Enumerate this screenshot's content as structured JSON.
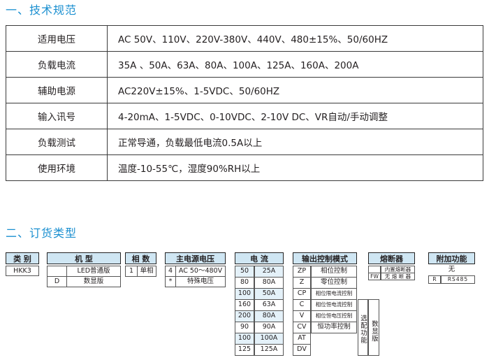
{
  "section1_title": "一、技术规范",
  "specs": [
    {
      "k": "适用电压",
      "v": "AC 50V、110V、220V-380V、440V、480±15%、50/60HZ"
    },
    {
      "k": "负载电流",
      "v": "35A 、50A、63A、80A、100A、125A、160A、200A"
    },
    {
      "k": "辅助电源",
      "v": "AC220V±15%、1-5VDC、50/60HZ"
    },
    {
      "k": "输入讯号",
      "v": "4-20mA、1-5VDC、0-10VDC、2-10V DC、VR自动/手动调整"
    },
    {
      "k": "负载测试",
      "v": "正常导通，负载最低电流0.5A以上"
    },
    {
      "k": "使用环境",
      "v": "温度-10-55℃，湿度90%RH以上"
    }
  ],
  "section2_title": "二、订货类型",
  "order": {
    "type": {
      "header": "类 别",
      "value": "HKK3"
    },
    "model": {
      "header": "机 型",
      "rows": [
        {
          "code": "",
          "desc": "LED普通版"
        },
        {
          "code": "D",
          "desc": "数显版"
        }
      ]
    },
    "phase": {
      "header": "相 数",
      "code": "1",
      "desc": "单相"
    },
    "voltage": {
      "header": "主电源电压",
      "rows": [
        {
          "code": "4",
          "desc": "AC 50～480V"
        },
        {
          "code": "*",
          "desc": "特殊电压"
        }
      ]
    },
    "current": {
      "header": "电 流",
      "rows": [
        {
          "code": "50",
          "value": "25A"
        },
        {
          "code": "80",
          "value": "80A"
        },
        {
          "code": "100",
          "value": "50A"
        },
        {
          "code": "160",
          "value": "63A"
        },
        {
          "code": "200",
          "value": "80A"
        },
        {
          "code": "90",
          "value": "90A"
        },
        {
          "code": "100",
          "value": "100A"
        },
        {
          "code": "125",
          "value": "125A"
        }
      ]
    },
    "control": {
      "header": "输出控制模式",
      "rows": [
        {
          "code": "ZP",
          "desc": "相位控制"
        },
        {
          "code": "Z",
          "desc": "零位控制"
        },
        {
          "code": "CP",
          "desc": "相位限电流控制"
        },
        {
          "code": "C",
          "desc": "相位恒电流控制"
        },
        {
          "code": "V",
          "desc": "相位恒电压控制"
        },
        {
          "code": "CV",
          "desc": "恒功率控制"
        },
        {
          "code": "AT",
          "desc": ""
        },
        {
          "code": "DV",
          "desc": ""
        }
      ],
      "side1": "选配功能",
      "side2": "数显版"
    },
    "fuse": {
      "header": "熔断器",
      "rows": [
        {
          "code": "",
          "desc": "内置熔断器"
        },
        {
          "code": "FW",
          "desc": "无 熔 断 器"
        }
      ]
    },
    "extra": {
      "header": "附加功能",
      "rows": [
        {
          "code": "",
          "desc": "无"
        },
        {
          "code": "R",
          "desc": "RS485"
        }
      ]
    }
  },
  "colors": {
    "heading": "#1a8fd0",
    "box_fill": "#cfe6f3",
    "row_shade": "#e4f1f9"
  }
}
